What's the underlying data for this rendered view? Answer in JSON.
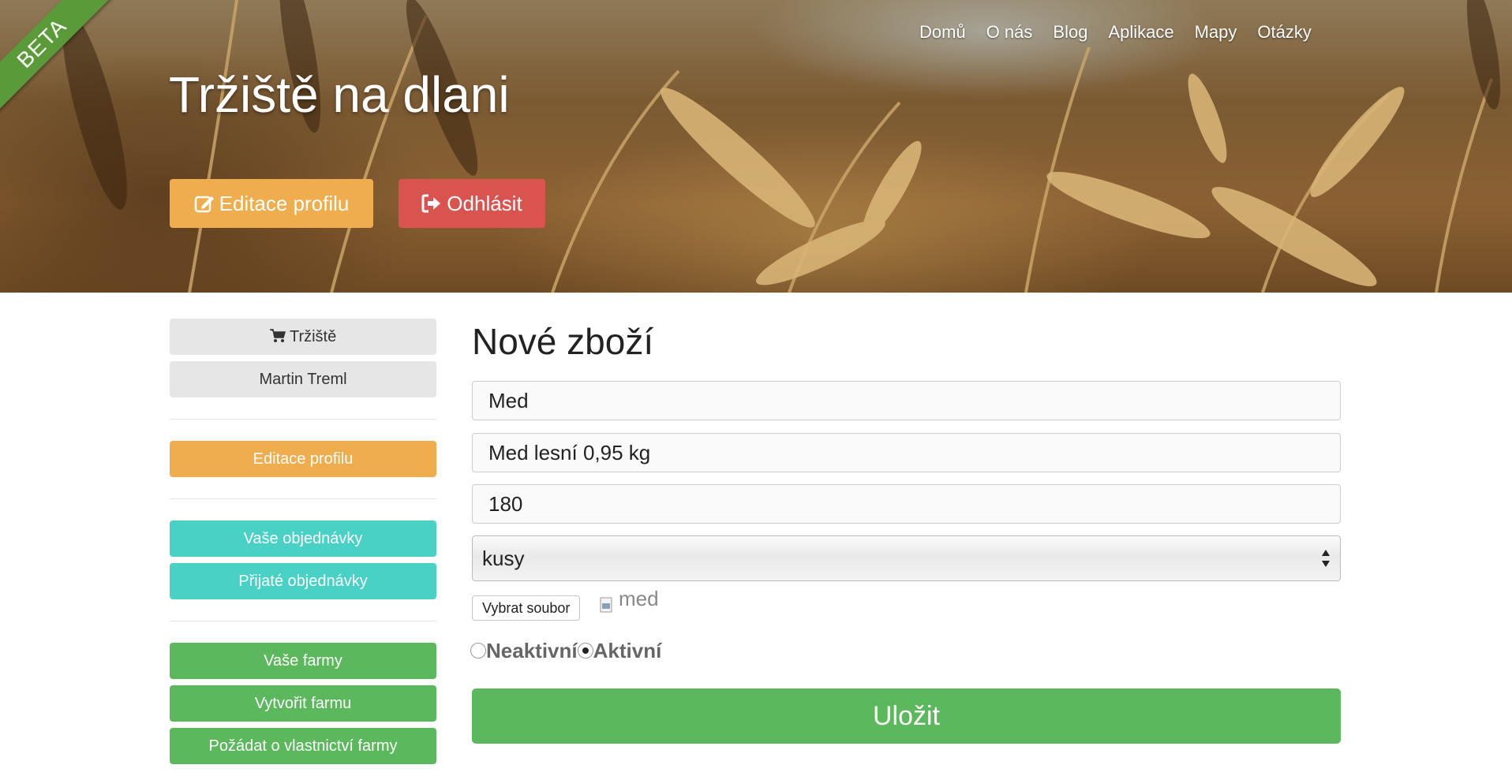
{
  "badge": {
    "beta": "BETA"
  },
  "nav": {
    "items": [
      {
        "label": "Domů"
      },
      {
        "label": "O nás"
      },
      {
        "label": "Blog"
      },
      {
        "label": "Aplikace"
      },
      {
        "label": "Mapy"
      },
      {
        "label": "Otázky"
      }
    ]
  },
  "header": {
    "title": "Tržiště na dlani",
    "edit_profile_label": "Editace profilu",
    "edit_icon": "pencil-square-icon",
    "logout_label": "Odhlásit",
    "logout_icon": "sign-out-icon"
  },
  "sidebar": {
    "market_label": "Tržiště",
    "market_icon": "cart-icon",
    "user_name": "Martin Treml",
    "edit_profile_label": "Editace profilu",
    "your_orders_label": "Vaše objednávky",
    "received_orders_label": "Přijaté objednávky",
    "your_farms_label": "Vaše farmy",
    "create_farm_label": "Vytvořit farmu",
    "request_ownership_label": "Požádat o vlastnictví farmy"
  },
  "form": {
    "title": "Nové zboží",
    "name_value": "Med",
    "description_value": "Med lesní 0,95 kg",
    "price_value": "180",
    "unit_selected": "kusy",
    "file_button_label": "Vybrat soubor",
    "file_name": "med",
    "radio_inactive_label": "Neaktivní",
    "radio_active_label": "Aktivní",
    "active_selected": true,
    "save_label": "Uložit"
  },
  "colors": {
    "orange": "#f0ad4e",
    "red": "#d9534f",
    "teal": "#48d1c4",
    "green": "#5cb85c",
    "beta_green": "#5a9a38"
  }
}
